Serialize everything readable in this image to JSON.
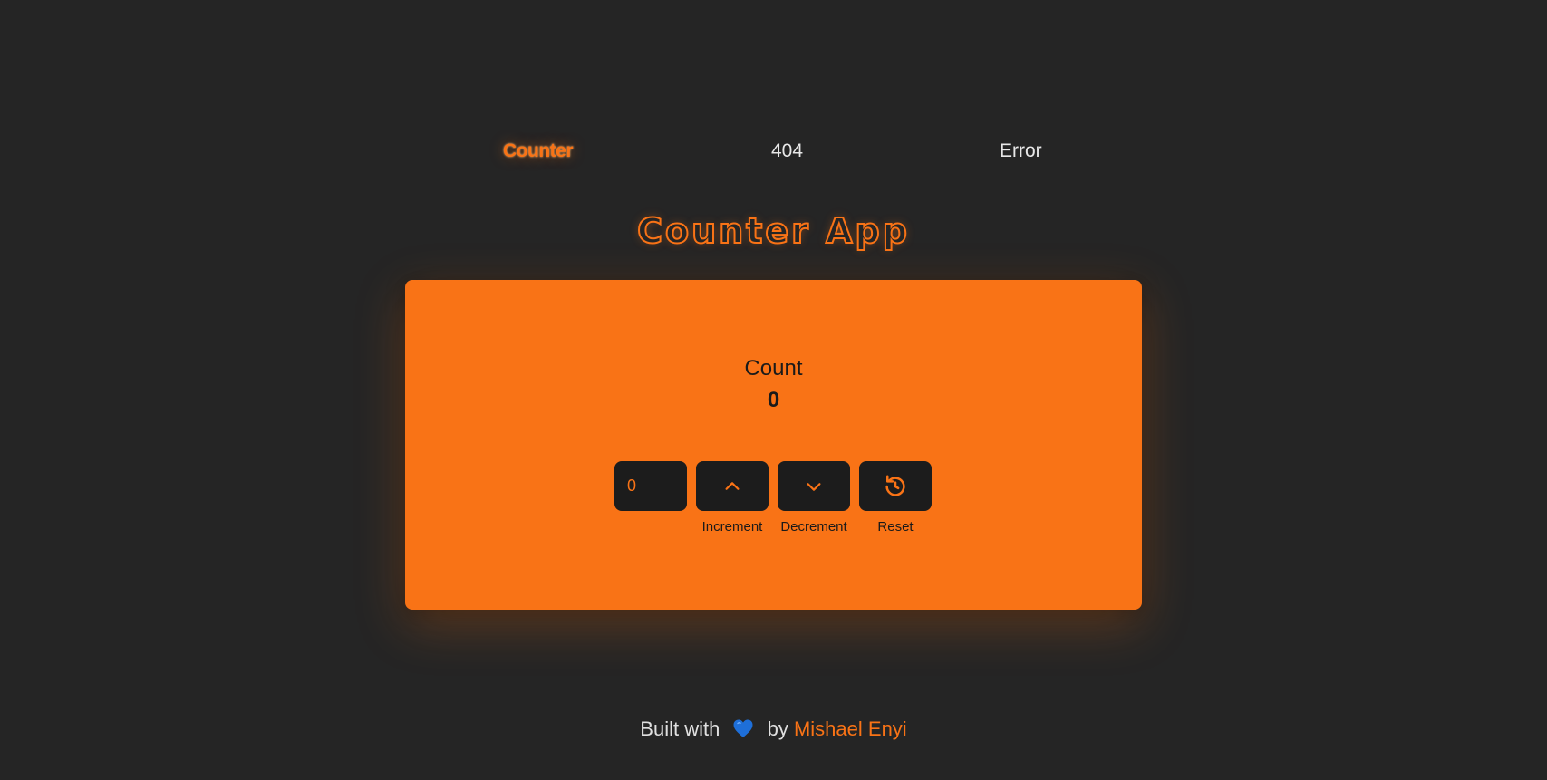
{
  "nav": {
    "items": [
      {
        "label": "Counter",
        "active": true
      },
      {
        "label": "404",
        "active": false
      },
      {
        "label": "Error",
        "active": false
      }
    ]
  },
  "header": {
    "title": "Counter App"
  },
  "counter": {
    "label": "Count",
    "value": "0",
    "input_value": "0",
    "buttons": {
      "increment": {
        "label": "Increment",
        "icon": "chevron-up-icon"
      },
      "decrement": {
        "label": "Decrement",
        "icon": "chevron-down-icon"
      },
      "reset": {
        "label": "Reset",
        "icon": "rotate-ccw-icon"
      }
    }
  },
  "footer": {
    "prefix": "Built with",
    "heart_icon": "blue-heart-icon",
    "middle": "by",
    "author": "Mishael Enyi"
  },
  "colors": {
    "background": "#252525",
    "accent": "#f97316",
    "button_bg": "#1c1c1c",
    "heart": "#1e6fd9"
  }
}
